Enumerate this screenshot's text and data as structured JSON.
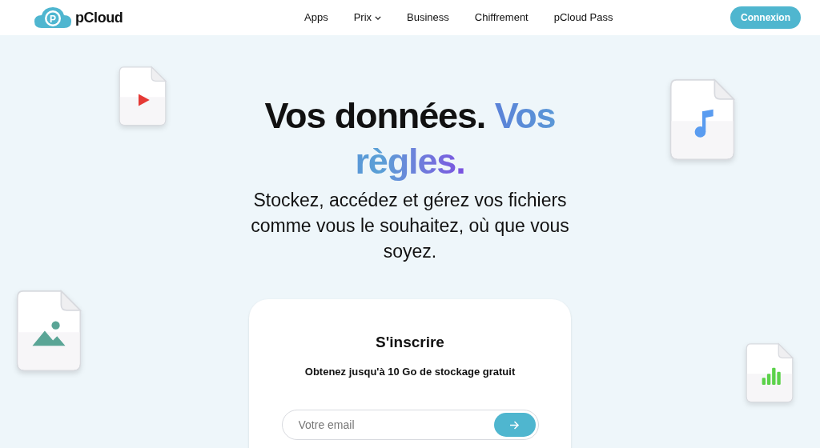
{
  "header": {
    "logo_text": "pCloud",
    "logo_letter": "P",
    "nav": [
      {
        "label": "Apps",
        "has_menu": false
      },
      {
        "label": "Prix",
        "has_menu": true
      },
      {
        "label": "Business",
        "has_menu": false
      },
      {
        "label": "Chiffrement",
        "has_menu": false
      },
      {
        "label": "pCloud Pass",
        "has_menu": false
      }
    ],
    "login_button": "Connexion"
  },
  "hero": {
    "headline_dark": "Vos données.",
    "headline_accent": "Vos règles.",
    "subtitle": "Stockez, accédez et gérez vos fichiers comme vous le souhaitez, où que vous soyez."
  },
  "floating_files": [
    {
      "kind": "video"
    },
    {
      "kind": "music"
    },
    {
      "kind": "image"
    },
    {
      "kind": "chart"
    }
  ],
  "signup": {
    "title": "S'inscrire",
    "subtitle": "Obtenez jusqu'à 10 Go de stockage gratuit",
    "email": {
      "placeholder": "Votre email"
    }
  }
}
